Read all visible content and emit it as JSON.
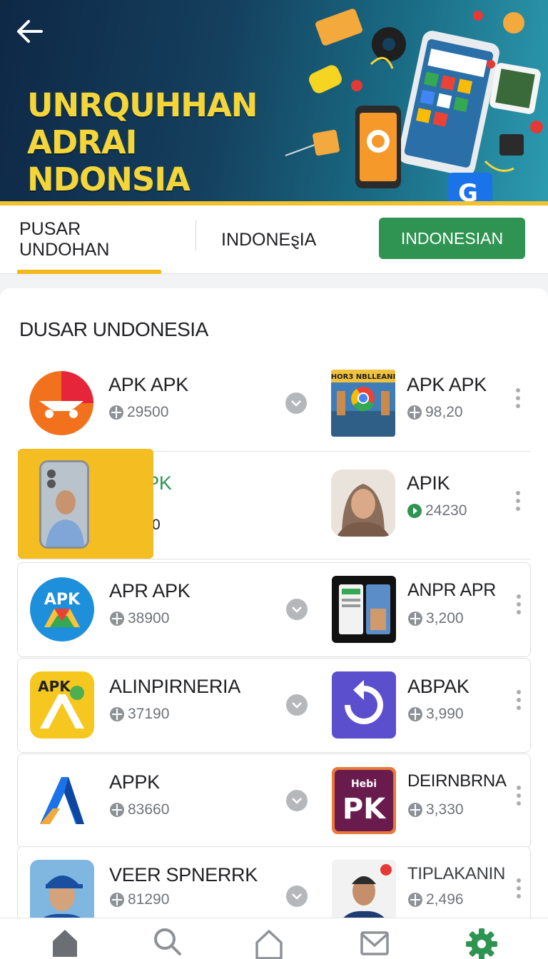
{
  "banner": {
    "title_line1": "UNRQUHHAN",
    "title_line2": "ADRAI NDONSIA",
    "accent_color": "#f2c12e"
  },
  "tabs": {
    "tab1_label": "PUSAR UNDOHAN",
    "tab2_label": "INDONEȿIA",
    "button_label": "INDONESIAN",
    "button_color": "#2f9452",
    "active_tab": "PUSAR UNDOHAN"
  },
  "section": {
    "title": "DUSAR UNDONESIA"
  },
  "rows": [
    {
      "left": {
        "name": "APK APK",
        "meta": "29500",
        "icon": "delivery-app-icon"
      },
      "right": {
        "name": "APK APK",
        "meta": "98,20",
        "icon": "chrome-city-icon",
        "icon_text": "HOR3 NBLLEANI"
      }
    },
    {
      "left": {
        "name": "APPPK",
        "meta": "9930",
        "icon": "phone-portrait-icon"
      },
      "right": {
        "name": "APIK",
        "meta": "24230",
        "icon": "woman-portrait-icon"
      }
    },
    {
      "left": {
        "name": "APR APK",
        "meta": "38900",
        "icon": "apk-drive-icon",
        "icon_text": "APK"
      },
      "right": {
        "name": "ANPR APR",
        "meta": "3,200",
        "icon": "phones-screenshot-icon"
      }
    },
    {
      "left": {
        "name": "ALINPIRNERIA",
        "meta": "37190",
        "icon": "apk-yellow-icon",
        "icon_text": "APK"
      },
      "right": {
        "name": "ABPAK",
        "meta": "3,990",
        "icon": "refresh-app-icon"
      }
    },
    {
      "left": {
        "name": "APPK",
        "meta": "83660",
        "icon": "a-logo-icon"
      },
      "right": {
        "name": "DEIRNBRNA",
        "meta": "3,330",
        "icon": "pk-app-icon",
        "icon_small": "Hebi",
        "icon_big": "PK"
      }
    },
    {
      "left": {
        "name": "VEER SPNERRK",
        "meta": "81290",
        "icon": "man-cap-icon"
      },
      "right": {
        "name": "TIPLAKANIN",
        "meta": "2,496",
        "icon": "man-portrait-icon"
      }
    }
  ],
  "bottom_nav": {
    "items": [
      "home-icon",
      "search-icon",
      "house-outline-icon",
      "mail-icon",
      "settings-icon"
    ],
    "active": "settings-icon",
    "active_color": "#2f9452"
  }
}
